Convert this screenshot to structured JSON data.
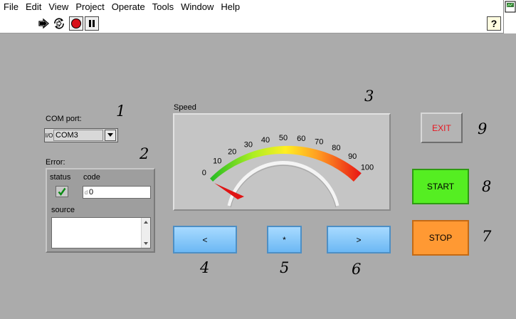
{
  "menu": [
    "File",
    "Edit",
    "View",
    "Project",
    "Operate",
    "Tools",
    "Window",
    "Help"
  ],
  "toolbar": {
    "run_icon": "run-arrow-icon",
    "continuous_icon": "run-continuously-icon",
    "abort_icon": "abort-stop-icon",
    "pause_icon": "pause-icon",
    "help_icon": "context-help-icon"
  },
  "com_port": {
    "label": "COM port:",
    "io_prefix": "I/O",
    "value": "COM3"
  },
  "error": {
    "label": "Error:",
    "status_label": "status",
    "code_label": "code",
    "code_prefix": "d",
    "code_value": "0",
    "source_label": "source",
    "source_value": ""
  },
  "speed": {
    "label": "Speed",
    "value": 0,
    "min": 0,
    "max": 100,
    "ticks": [
      "0",
      "10",
      "20",
      "30",
      "40",
      "50",
      "60",
      "70",
      "80",
      "90",
      "100"
    ]
  },
  "buttons": {
    "left": "<",
    "center": "*",
    "right": ">",
    "exit": "EXIT",
    "start": "START",
    "stop": "STOP"
  },
  "annotations": {
    "com": "1",
    "error": "2",
    "gauge": "3",
    "left": "4",
    "center": "5",
    "right": "6",
    "stop": "7",
    "start": "8",
    "exit": "9"
  },
  "colors": {
    "panel": "#ababab",
    "start": "#55ee22",
    "stop": "#ff9933",
    "exit": "#b4b4b4",
    "exit_text": "#e8141e",
    "nav": "#80c4f8"
  }
}
